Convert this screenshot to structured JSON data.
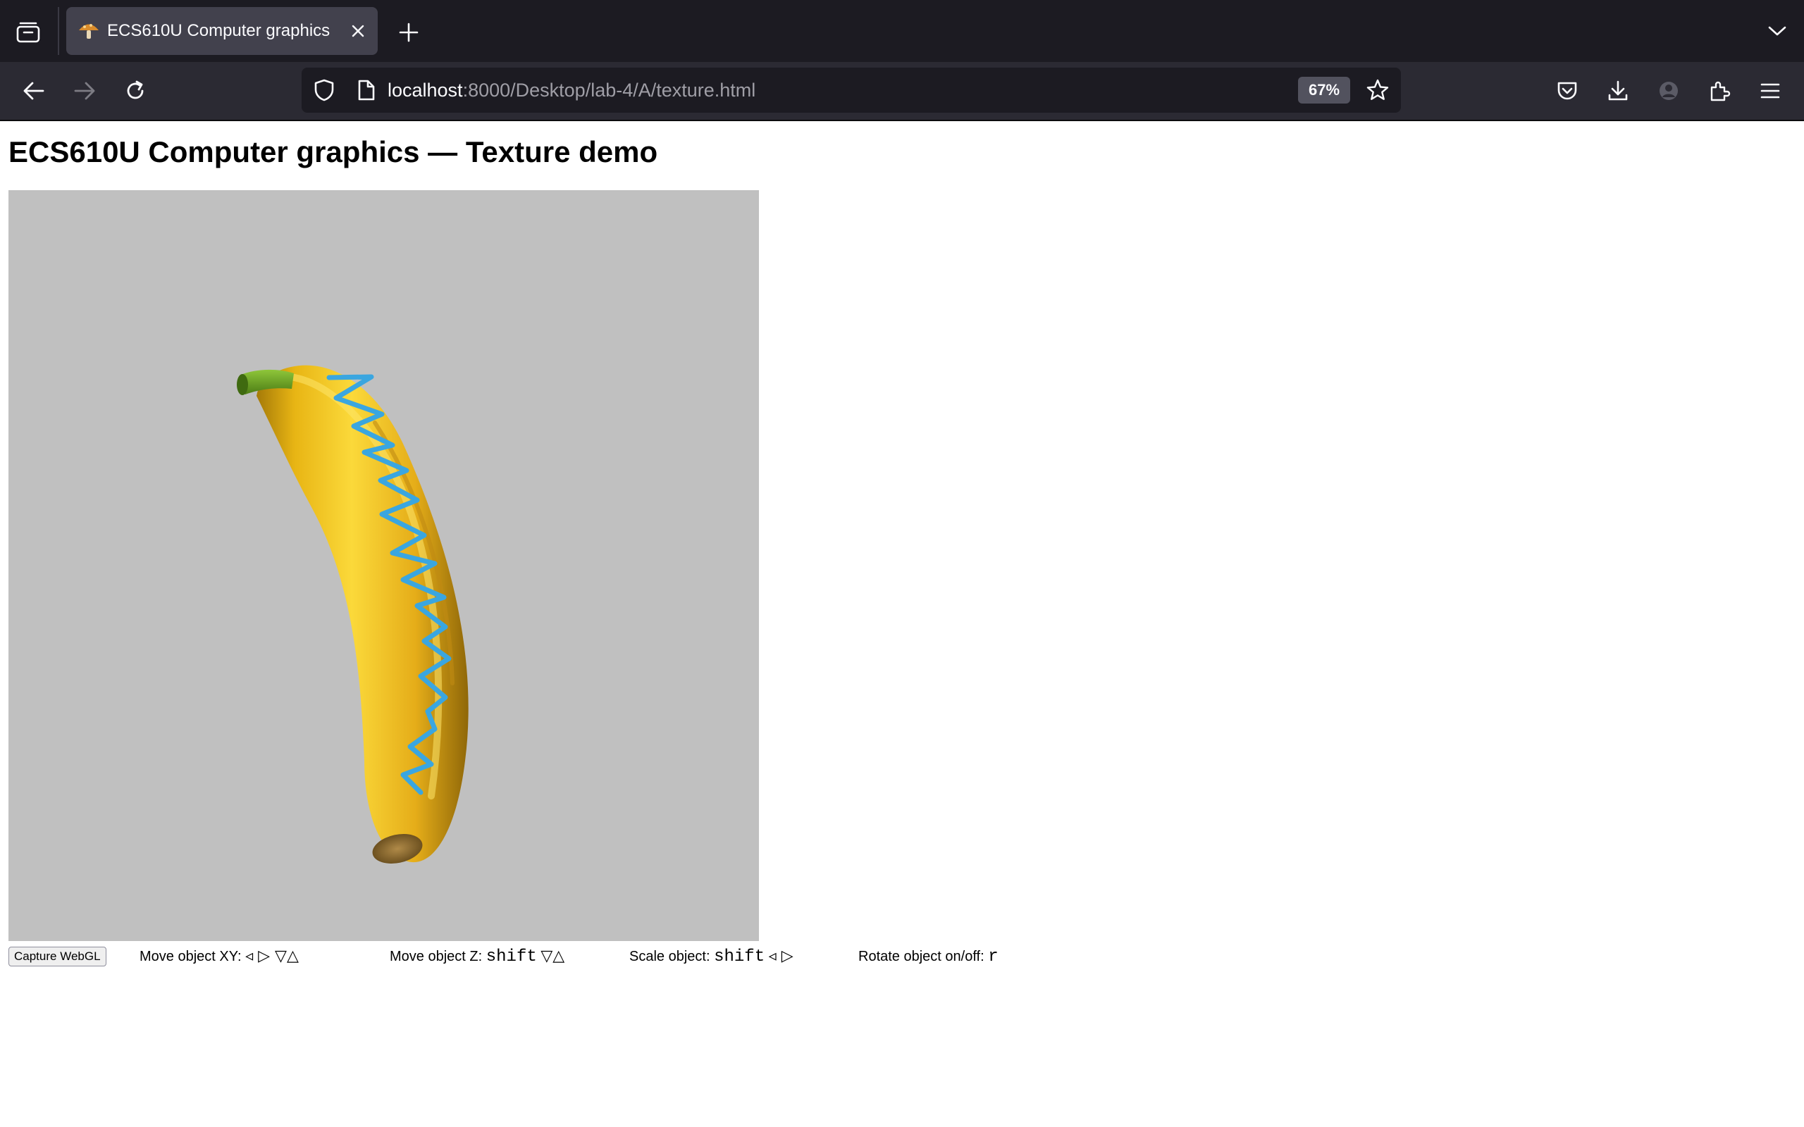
{
  "browser": {
    "tab": {
      "title": "ECS610U Computer graphics"
    },
    "url": {
      "host": "localhost",
      "rest": ":8000/Desktop/lab-4/A/texture.html"
    },
    "zoom": "67%",
    "icons": {
      "tabs_list": "tab-list-icon",
      "favicon": "mushroom-icon",
      "tab_close": "close-icon",
      "new_tab": "plus-icon",
      "tab_overflow": "chevron-down-icon",
      "back": "arrow-left-icon",
      "forward": "arrow-right-icon",
      "reload": "reload-icon",
      "tracking": "shield-icon",
      "page": "page-icon",
      "bookmark": "star-icon",
      "pocket": "pocket-icon",
      "downloads": "download-icon",
      "account": "account-icon",
      "extensions": "puzzle-icon",
      "menu": "hamburger-menu-icon"
    }
  },
  "page": {
    "heading": "ECS610U Computer graphics — Texture demo",
    "canvas": {
      "background": "#c0c0c0",
      "object": "textured banana"
    },
    "controls": {
      "capture_label": "Capture WebGL",
      "move_xy": {
        "label": "Move object XY:",
        "keys": "◃ ▷ ▽△"
      },
      "move_z": {
        "label": "Move object Z:",
        "modifier": "shift",
        "keys": "▽△"
      },
      "scale": {
        "label": "Scale object:",
        "modifier": "shift",
        "keys": "◃ ▷"
      },
      "rotate": {
        "label": "Rotate object on/off:",
        "key": "r"
      }
    }
  }
}
